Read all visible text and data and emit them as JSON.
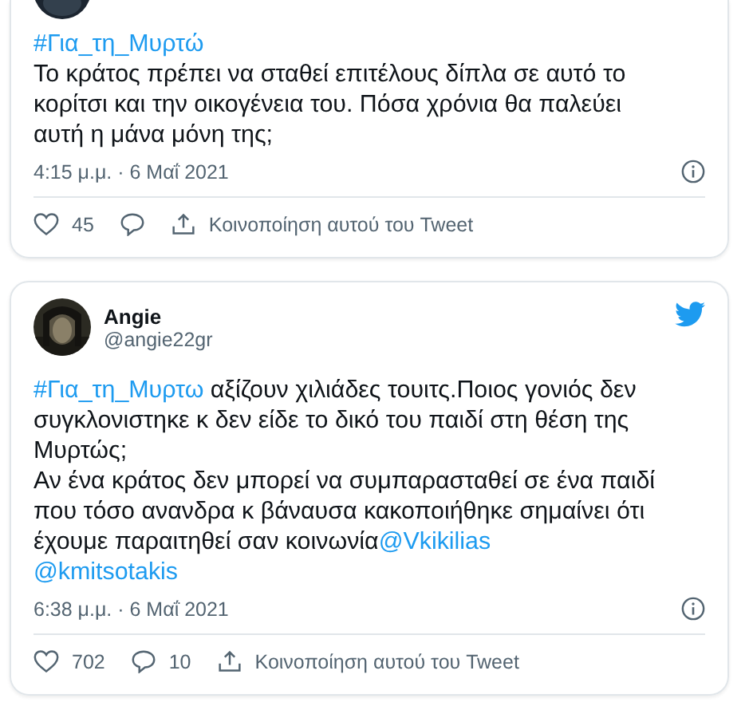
{
  "tweets": [
    {
      "parts": [
        {
          "kind": "hashtag",
          "text": "#Για_τη_Μυρτώ"
        },
        {
          "kind": "text",
          "text": "\nΤο κράτος πρέπει να σταθεί επιτέλους δίπλα σε αυτό το κορίτσι και την οικογένεια του. Πόσα χρόνια θα παλεύει αυτή η μάνα μόνη της;"
        }
      ],
      "time": "4:15 μ.μ. · 6 Μαΐ 2021",
      "likes": "45",
      "share": "Κοινοποίηση αυτού του Tweet"
    },
    {
      "name": "Angie",
      "handle": "@angie22gr",
      "parts": [
        {
          "kind": "hashtag",
          "text": "#Για_τη_Μυρτω"
        },
        {
          "kind": "text",
          "text": " αξίζουν χιλιάδες τουιτς.Ποιος γονιός δεν συγκλονιστηκε κ δεν είδε το δικό του παιδί στη θέση της Μυρτώς;\nΑν ένα κράτος δεν μπορεί να συμπαρασταθεί σε ένα παιδί που τόσο ανανδρα κ βάναυσα κακοποιήθηκε σημαίνει ότι έχουμε παραιτηθεί σαν κοινωνία"
        },
        {
          "kind": "mention",
          "text": "@Vkikilias"
        },
        {
          "kind": "break"
        },
        {
          "kind": "mention",
          "text": "@kmitsotakis"
        }
      ],
      "time": "6:38 μ.μ. · 6 Μαΐ 2021",
      "likes": "702",
      "replies": "10",
      "share": "Κοινοποίηση αυτού του Tweet"
    }
  ]
}
